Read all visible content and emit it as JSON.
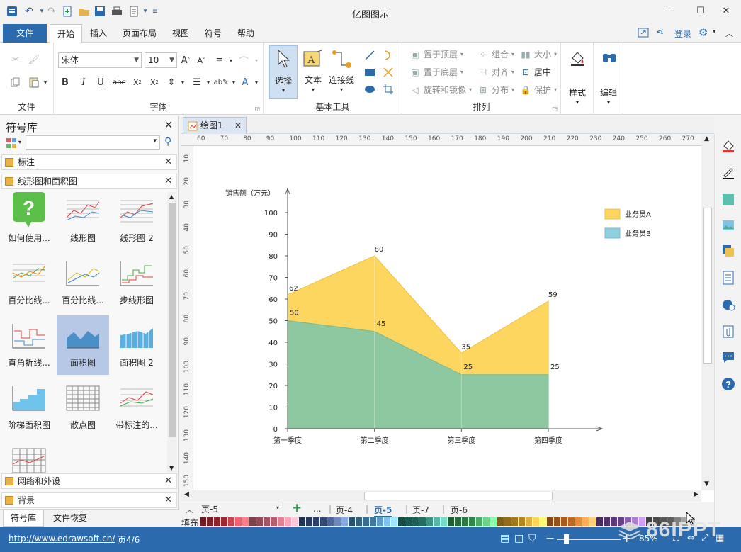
{
  "app": {
    "title": "亿图图示"
  },
  "menu": {
    "file": "文件",
    "tabs": [
      "开始",
      "插入",
      "页面布局",
      "视图",
      "符号",
      "帮助"
    ],
    "login": "登录"
  },
  "ribbon": {
    "groups": {
      "file": "文件",
      "font": "字体",
      "basic_tools": "基本工具",
      "arrange": "排列"
    },
    "font": {
      "name": "宋体",
      "size": "10"
    },
    "tools": {
      "select": "选择",
      "text": "文本",
      "connector": "连接线"
    },
    "arrange": {
      "bring_front": "置于顶层",
      "send_back": "置于底层",
      "rotate": "旋转和镜像",
      "group": "组合",
      "align": "对齐",
      "distribute": "分布",
      "size": "大小",
      "center": "居中",
      "protect": "保护"
    },
    "style": "样式",
    "edit": "编辑"
  },
  "library": {
    "title": "符号库",
    "sections": {
      "annotation": "标注",
      "line_area": "线形图和面积图",
      "network": "网络和外设",
      "background": "背景"
    },
    "symbols": [
      "如何使用...",
      "线形图",
      "线形图 2",
      "百分比线...",
      "百分比线...",
      "步线形图",
      "直角折线...",
      "面积图",
      "面积图 2",
      "阶梯面积图",
      "散点图",
      "带标注的..."
    ],
    "selected_index": 7
  },
  "bottom_tabs": [
    "符号库",
    "文件恢复"
  ],
  "document": {
    "tab": "绘图1"
  },
  "ruler": {
    "h": [
      "60",
      "70",
      "80",
      "90",
      "100",
      "110",
      "120",
      "130",
      "140",
      "150",
      "160",
      "170",
      "180",
      "190",
      "200",
      "210",
      "220",
      "230",
      "240",
      "250",
      "260",
      "270",
      "28"
    ],
    "v": [
      "10",
      "20",
      "30",
      "40",
      "50",
      "60",
      "70",
      "80",
      "90",
      "100",
      "110",
      "120",
      "130",
      "140",
      "150"
    ]
  },
  "chart_data": {
    "type": "area",
    "ylabel": "销售额（万元）",
    "categories": [
      "第一季度",
      "第二季度",
      "第三季度",
      "第四季度"
    ],
    "ylim": [
      0,
      100
    ],
    "yticks": [
      0,
      10,
      20,
      30,
      40,
      50,
      60,
      70,
      80,
      90,
      100
    ],
    "series": [
      {
        "name": "业务员A",
        "values": [
          62,
          80,
          35,
          59
        ],
        "color": "#fdd660"
      },
      {
        "name": "业务员B",
        "values": [
          50,
          45,
          25,
          25
        ],
        "color": "#8ec8a0"
      }
    ],
    "legend_position": "top-right",
    "legend_colors": {
      "a": "#fdd660",
      "b": "#8ecfe0"
    }
  },
  "pages": {
    "current_select": "页-5",
    "list": [
      "页-4",
      "页-5",
      "页-7",
      "页-6"
    ],
    "active": "页-5",
    "ellipsis": "..."
  },
  "fill_label": "填充",
  "status": {
    "url": "http://www.edrawsoft.cn/",
    "page": "页4/6",
    "zoom": "85%"
  },
  "watermark": "86IPPT"
}
